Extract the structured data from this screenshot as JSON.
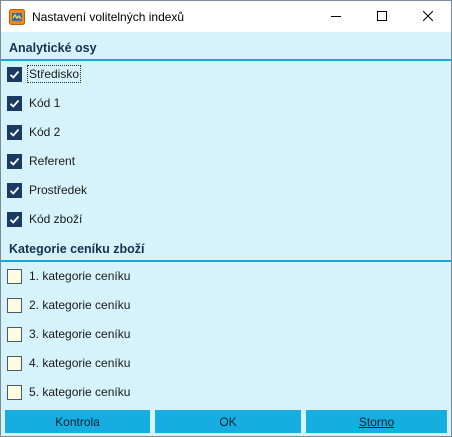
{
  "window": {
    "title": "Nastavení volitelných indexů",
    "icon": "app-icon"
  },
  "analytic_section": {
    "title": "Analytické osy",
    "items": [
      {
        "label": "Středisko",
        "checked": true
      },
      {
        "label": "Kód 1",
        "checked": true
      },
      {
        "label": "Kód 2",
        "checked": true
      },
      {
        "label": "Referent",
        "checked": true
      },
      {
        "label": "Prostředek",
        "checked": true
      },
      {
        "label": "Kód zboží",
        "checked": true
      }
    ]
  },
  "price_section": {
    "title": "Kategorie ceníku zboží",
    "items": [
      {
        "label": "1. kategorie ceníku",
        "checked": false
      },
      {
        "label": "2. kategorie ceníku",
        "checked": false
      },
      {
        "label": "3. kategorie ceníku",
        "checked": false
      },
      {
        "label": "4. kategorie ceníku",
        "checked": false
      },
      {
        "label": "5. kategorie ceníku",
        "checked": false
      }
    ]
  },
  "buttons": {
    "check_label": "Kontrola",
    "ok_label": "OK",
    "cancel_label": "Storno"
  },
  "colors": {
    "background": "#d6f3fb",
    "accent": "#16aee0",
    "checkbox_checked": "#1b3a63",
    "checkbox_unchecked": "#fffbe0"
  }
}
